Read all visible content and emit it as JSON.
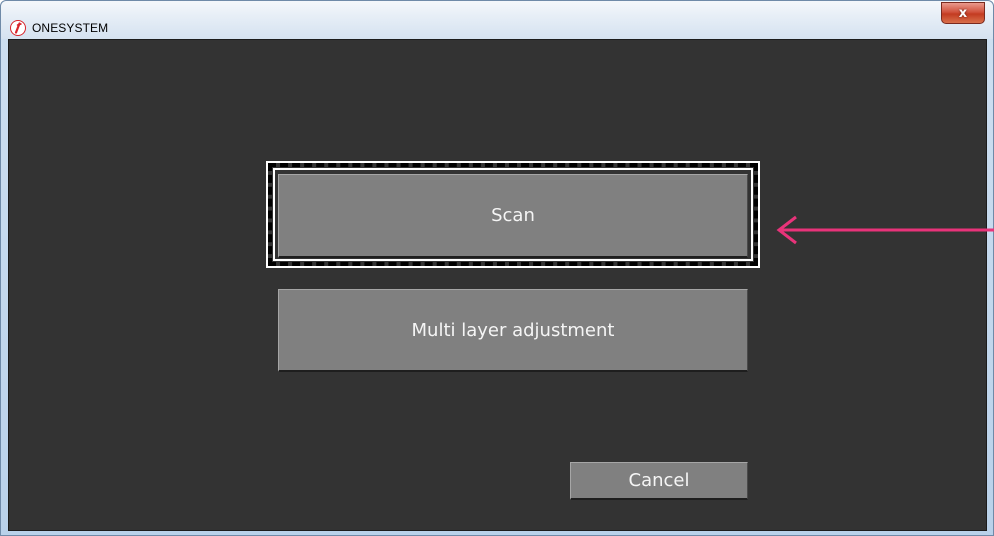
{
  "window": {
    "title": "ONESYSTEM",
    "close_label": "x"
  },
  "buttons": {
    "scan_label": "Scan",
    "multi_layer_label": "Multi layer adjustment",
    "cancel_label": "Cancel"
  },
  "colors": {
    "client_background": "#333333",
    "button_face": "#808080",
    "annotation_arrow": "#e8337a"
  },
  "icons": {
    "app": "onesystem-logo-icon",
    "close": "close-icon",
    "annotation": "arrow-left-icon"
  }
}
